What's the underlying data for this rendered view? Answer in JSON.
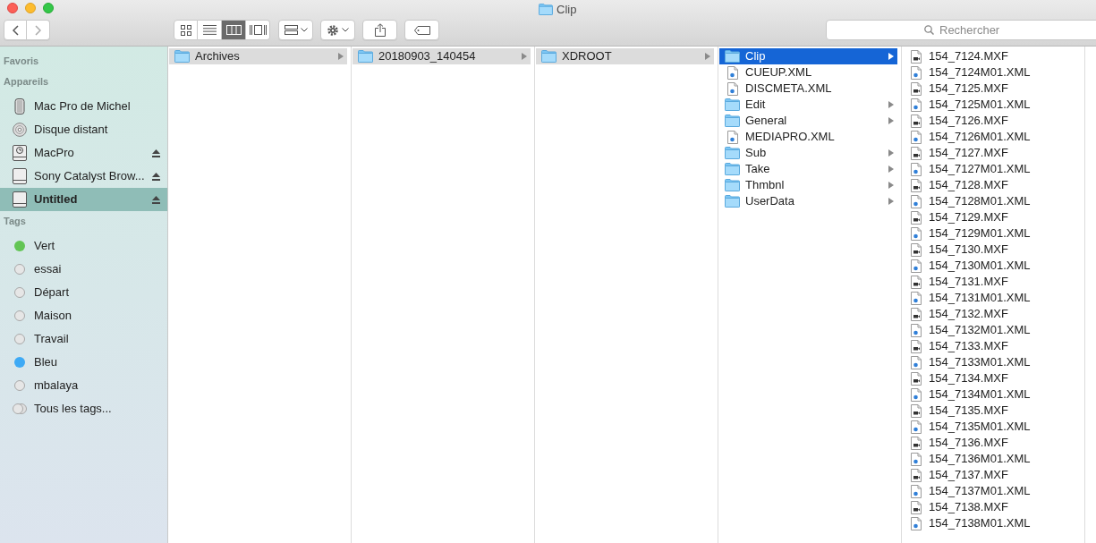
{
  "window": {
    "title": "Clip"
  },
  "toolbar": {
    "views": [
      {
        "kind": "icons",
        "selected": false
      },
      {
        "kind": "list",
        "selected": false
      },
      {
        "kind": "columns",
        "selected": true
      },
      {
        "kind": "gallery",
        "selected": false
      }
    ],
    "search": {
      "placeholder": "Rechercher"
    }
  },
  "sidebar": {
    "sections": [
      {
        "title": "Favoris"
      },
      {
        "title": "Appareils",
        "items": [
          {
            "kind": "computer",
            "label": "Mac Pro de Michel",
            "eject": false,
            "selected": false
          },
          {
            "kind": "disc",
            "label": "Disque distant",
            "eject": false,
            "selected": false
          },
          {
            "kind": "backup-drive",
            "label": "MacPro",
            "eject": true,
            "selected": false
          },
          {
            "kind": "drive",
            "label": "Sony Catalyst Brow...",
            "eject": true,
            "selected": false
          },
          {
            "kind": "drive",
            "label": "Untitled",
            "eject": true,
            "selected": true
          }
        ]
      },
      {
        "title": "Tags",
        "items": [
          {
            "kind": "tag",
            "label": "Vert",
            "color": "#62c554"
          },
          {
            "kind": "tag",
            "label": "essai"
          },
          {
            "kind": "tag",
            "label": "Départ"
          },
          {
            "kind": "tag",
            "label": "Maison"
          },
          {
            "kind": "tag",
            "label": "Travail"
          },
          {
            "kind": "tag",
            "label": "Bleu",
            "color": "#3eaaf5"
          },
          {
            "kind": "tag",
            "label": "mbalaya"
          },
          {
            "kind": "all-tags",
            "label": "Tous les tags..."
          }
        ]
      }
    ]
  },
  "columns": [
    {
      "focused": false,
      "items": [
        {
          "kind": "folder",
          "name": "Archives",
          "selected": true
        }
      ]
    },
    {
      "focused": false,
      "items": [
        {
          "kind": "folder",
          "name": "20180903_140454",
          "selected": true
        }
      ]
    },
    {
      "focused": false,
      "items": [
        {
          "kind": "folder",
          "name": "XDROOT",
          "selected": true
        }
      ]
    },
    {
      "focused": true,
      "items": [
        {
          "kind": "folder",
          "name": "Clip",
          "selected": true
        },
        {
          "kind": "xml",
          "name": "CUEUP.XML",
          "selected": false
        },
        {
          "kind": "xml",
          "name": "DISCMETA.XML",
          "selected": false
        },
        {
          "kind": "folder",
          "name": "Edit",
          "selected": false
        },
        {
          "kind": "folder",
          "name": "General",
          "selected": false
        },
        {
          "kind": "xml",
          "name": "MEDIAPRO.XML",
          "selected": false
        },
        {
          "kind": "folder",
          "name": "Sub",
          "selected": false
        },
        {
          "kind": "folder",
          "name": "Take",
          "selected": false
        },
        {
          "kind": "folder",
          "name": "Thmbnl",
          "selected": false
        },
        {
          "kind": "folder",
          "name": "UserData",
          "selected": false
        }
      ]
    },
    {
      "items": [
        {
          "kind": "mxf",
          "name": "154_7124.MXF",
          "selected": false
        },
        {
          "kind": "xml",
          "name": "154_7124M01.XML",
          "selected": false
        },
        {
          "kind": "mxf",
          "name": "154_7125.MXF",
          "selected": false
        },
        {
          "kind": "xml",
          "name": "154_7125M01.XML",
          "selected": false
        },
        {
          "kind": "mxf",
          "name": "154_7126.MXF",
          "selected": false
        },
        {
          "kind": "xml",
          "name": "154_7126M01.XML",
          "selected": false
        },
        {
          "kind": "mxf",
          "name": "154_7127.MXF",
          "selected": false
        },
        {
          "kind": "xml",
          "name": "154_7127M01.XML",
          "selected": false
        },
        {
          "kind": "mxf",
          "name": "154_7128.MXF",
          "selected": false
        },
        {
          "kind": "xml",
          "name": "154_7128M01.XML",
          "selected": false
        },
        {
          "kind": "mxf",
          "name": "154_7129.MXF",
          "selected": false
        },
        {
          "kind": "xml",
          "name": "154_7129M01.XML",
          "selected": false
        },
        {
          "kind": "mxf",
          "name": "154_7130.MXF",
          "selected": false
        },
        {
          "kind": "xml",
          "name": "154_7130M01.XML",
          "selected": false
        },
        {
          "kind": "mxf",
          "name": "154_7131.MXF",
          "selected": false
        },
        {
          "kind": "xml",
          "name": "154_7131M01.XML",
          "selected": false
        },
        {
          "kind": "mxf",
          "name": "154_7132.MXF",
          "selected": false
        },
        {
          "kind": "xml",
          "name": "154_7132M01.XML",
          "selected": false
        },
        {
          "kind": "mxf",
          "name": "154_7133.MXF",
          "selected": false
        },
        {
          "kind": "xml",
          "name": "154_7133M01.XML",
          "selected": false
        },
        {
          "kind": "mxf",
          "name": "154_7134.MXF",
          "selected": false
        },
        {
          "kind": "xml",
          "name": "154_7134M01.XML",
          "selected": false
        },
        {
          "kind": "mxf",
          "name": "154_7135.MXF",
          "selected": false
        },
        {
          "kind": "xml",
          "name": "154_7135M01.XML",
          "selected": false
        },
        {
          "kind": "mxf",
          "name": "154_7136.MXF",
          "selected": false
        },
        {
          "kind": "xml",
          "name": "154_7136M01.XML",
          "selected": false
        },
        {
          "kind": "mxf",
          "name": "154_7137.MXF",
          "selected": false
        },
        {
          "kind": "xml",
          "name": "154_7137M01.XML",
          "selected": false
        },
        {
          "kind": "mxf",
          "name": "154_7138.MXF",
          "selected": false
        },
        {
          "kind": "xml",
          "name": "154_7138M01.XML",
          "selected": false
        }
      ]
    }
  ]
}
